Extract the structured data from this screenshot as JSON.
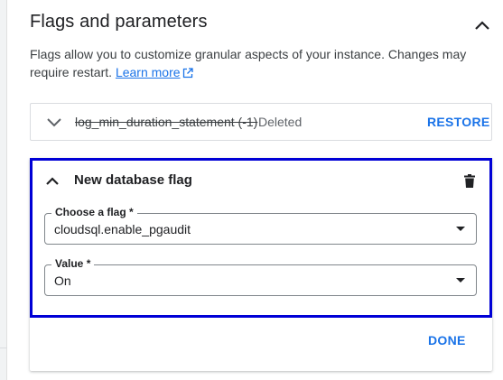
{
  "section": {
    "title": "Flags and parameters",
    "collapse_icon": "chevron-up-icon"
  },
  "description": {
    "text": "Flags allow you to customize granular aspects of your instance. Changes may require restart.",
    "link_label": "Learn more",
    "link_icon": "open-in-new-icon"
  },
  "deleted_flag": {
    "name": "log_min_duration_statement (-1)",
    "status": "Deleted",
    "action_label": "RESTORE",
    "expand_icon": "chevron-down-icon"
  },
  "new_flag": {
    "title": "New database flag",
    "delete_icon": "trash-icon",
    "flag_field": {
      "label": "Choose a flag *",
      "value": "cloudsql.enable_pgaudit"
    },
    "value_field": {
      "label": "Value *",
      "value": "On"
    },
    "done_label": "DONE"
  },
  "colors": {
    "accent": "#1a73e8",
    "highlight_border": "#0000d6",
    "text": "#202124"
  }
}
